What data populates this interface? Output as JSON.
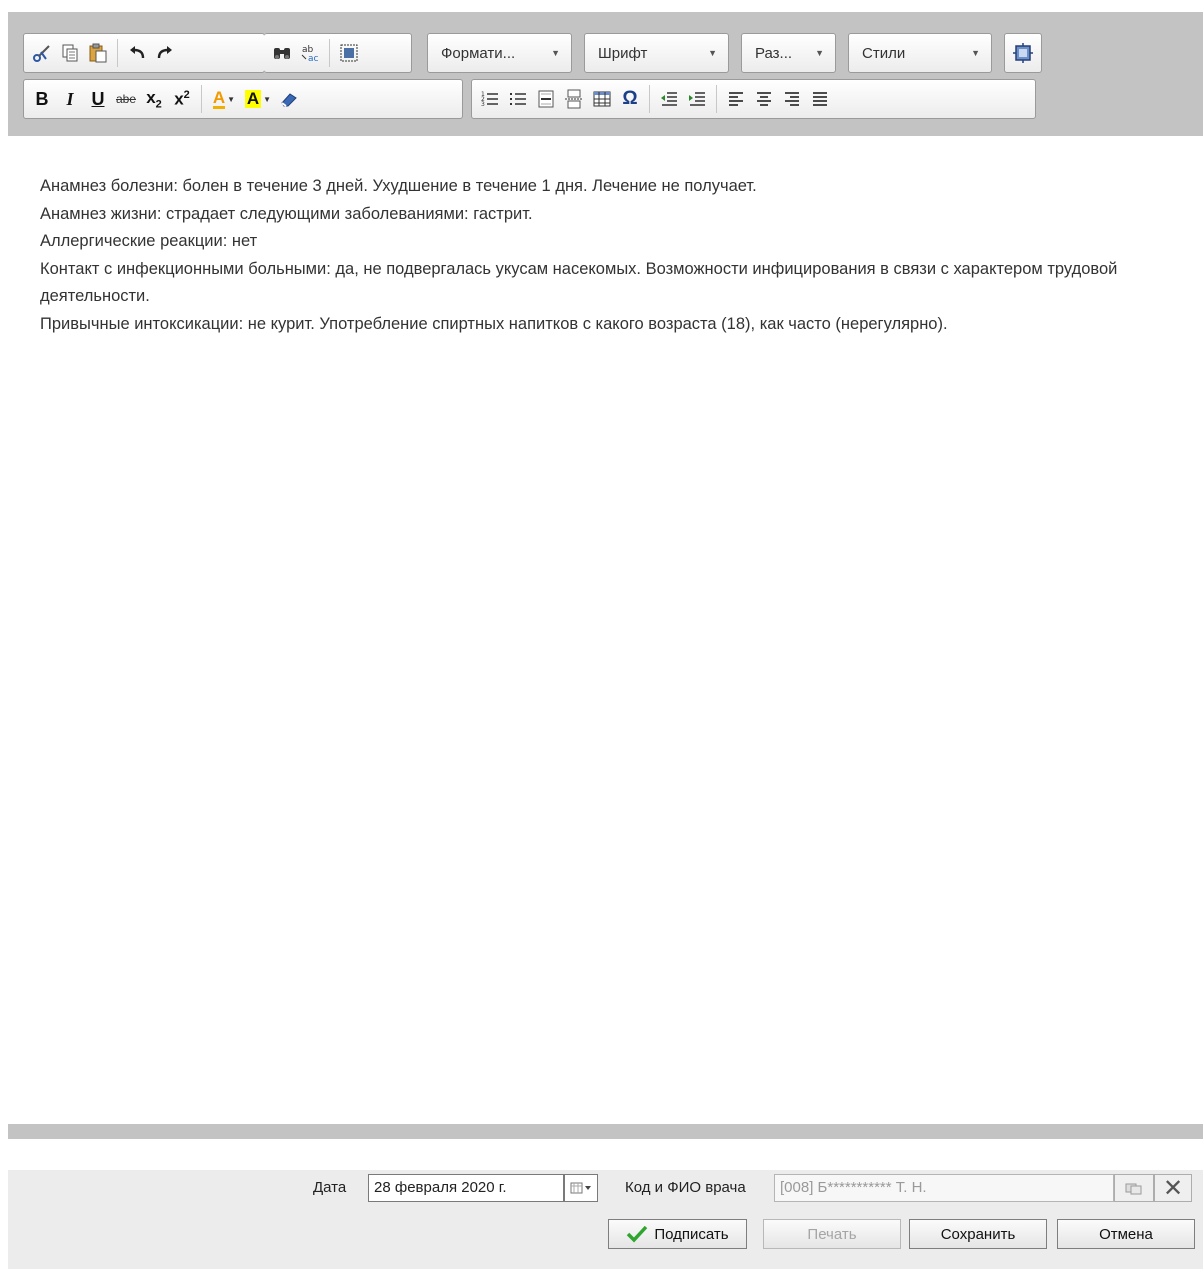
{
  "toolbar": {
    "row1": {
      "g1": [
        {
          "name": "scissors-icon",
          "glyph": "✂",
          "color": "#3a68b4"
        },
        {
          "name": "copy-icon",
          "glyph": "⎘",
          "color": "#555555"
        },
        {
          "name": "paste-icon",
          "glyph": "📋",
          "color": "#9c6b1c"
        }
      ],
      "g2": [
        {
          "name": "undo-icon",
          "glyph": "↶",
          "color": "#2a2a2a"
        },
        {
          "name": "redo-icon",
          "glyph": "↷",
          "color": "#2a2a2a"
        }
      ],
      "g3": [
        {
          "name": "binoculars-find-icon",
          "glyph": "⚲",
          "color": "#333333"
        },
        {
          "name": "replace-icon",
          "glyph": "⇄",
          "color": "#333333"
        },
        {
          "name": "select-all-icon",
          "glyph": "⬚",
          "color": "#333333"
        }
      ],
      "format_label": "Формати...",
      "font_label": "Шрифт",
      "size_label": "Раз...",
      "styles_label": "Стили",
      "maximize_icon": "maximize-icon"
    },
    "row2": {
      "g1": [
        {
          "name": "bold-icon",
          "glyph": "B",
          "style": "bold"
        },
        {
          "name": "italic-icon",
          "glyph": "I",
          "style": "italic"
        },
        {
          "name": "underline-icon",
          "glyph": "U",
          "style": "underline"
        },
        {
          "name": "strikethrough-icon",
          "glyph": "abe",
          "style": "strike"
        },
        {
          "name": "subscript-icon",
          "glyph": "x₂",
          "style": "bold"
        },
        {
          "name": "superscript-icon",
          "glyph": "x²",
          "style": "bold"
        }
      ],
      "g2": [
        {
          "name": "text-color-icon",
          "glyph": "A",
          "color": "#f0a000"
        },
        {
          "name": "background-color-icon",
          "glyph": "A",
          "color": "#ffff00"
        },
        {
          "name": "eraser-icon",
          "glyph": "◢",
          "color": "#3a68b4"
        }
      ],
      "g3": [
        {
          "name": "numbered-list-icon",
          "glyph": "☰"
        },
        {
          "name": "bulleted-list-icon",
          "glyph": "☰"
        },
        {
          "name": "horizontal-line-icon",
          "glyph": "▤"
        },
        {
          "name": "page-break-icon",
          "glyph": "⤓"
        },
        {
          "name": "table-icon",
          "glyph": "▦"
        },
        {
          "name": "special-char-icon",
          "glyph": "Ω"
        }
      ],
      "g4": [
        {
          "name": "outdent-icon",
          "glyph": "⇤"
        },
        {
          "name": "indent-icon",
          "glyph": "⇥"
        }
      ],
      "g5": [
        {
          "name": "align-left-icon",
          "glyph": "≡"
        },
        {
          "name": "align-center-icon",
          "glyph": "≡"
        },
        {
          "name": "align-right-icon",
          "glyph": "≡"
        },
        {
          "name": "align-justify-icon",
          "glyph": "≣"
        }
      ]
    }
  },
  "editor": {
    "lines": [
      "Анамнез болезни: болен в течение 3 дней. Ухудшение в течение 1 дня. Лечение не получает.",
      "Анамнез жизни: страдает следующими заболеваниями: гастрит.",
      "Аллергические реакции: нет",
      "Контакт с инфекционными больными: да, не подвергалась укусам насекомых. Возможности инфицирования в связи с характером трудовой деятельности.",
      "Привычные интоксикации: не курит. Употребление спиртных напитков с какого возраста (18), как часто (нерегулярно)."
    ]
  },
  "footer": {
    "date_label": "Дата",
    "date_value": "28 февраля 2020 г.",
    "doctor_label": "Код и ФИО врача",
    "doctor_value": "[008] Б*********** Т. Н.",
    "sign_button": "Подписать",
    "print_button": "Печать",
    "save_button": "Сохранить",
    "cancel_button": "Отмена"
  },
  "colors": {
    "toolbar_bg": "#c3c3c3",
    "footer_bg": "#ececec",
    "check_green": "#2fa52f"
  }
}
